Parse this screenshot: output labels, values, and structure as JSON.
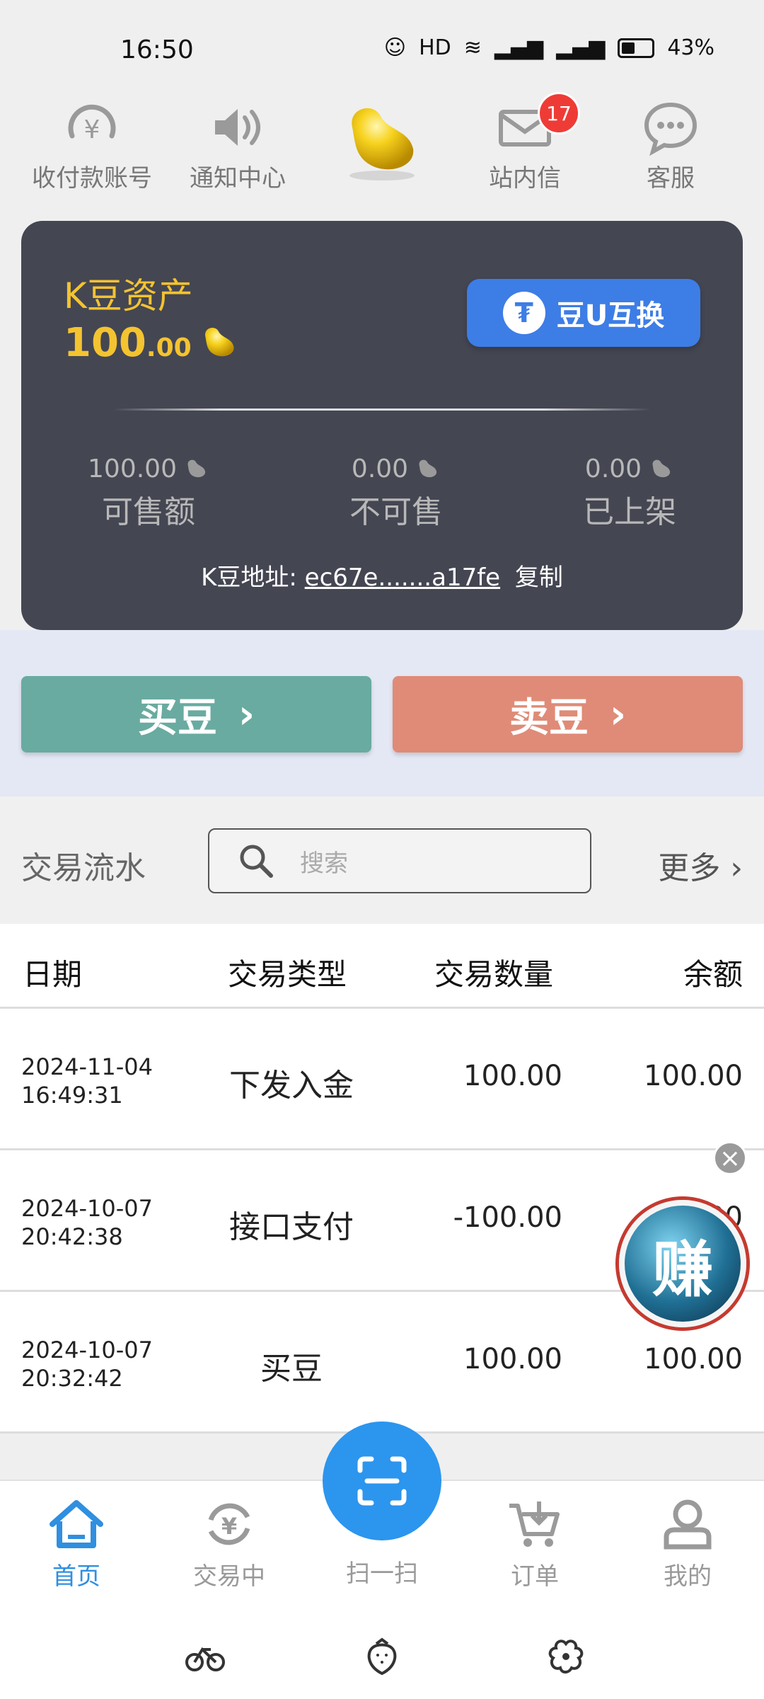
{
  "status": {
    "time": "16:50",
    "battery": "43%"
  },
  "topnav": {
    "items": [
      {
        "label": "收付款账号"
      },
      {
        "label": "通知中心"
      },
      {
        "label": "站内信",
        "badge": "17"
      },
      {
        "label": "客服"
      }
    ]
  },
  "card": {
    "title": "K豆资产",
    "amount_int": "100",
    "amount_dec": ".00",
    "swap_label": "豆U互换",
    "stats": [
      {
        "value": "100.00",
        "label": "可售额"
      },
      {
        "value": "0.00",
        "label": "不可售"
      },
      {
        "value": "0.00",
        "label": "已上架"
      }
    ],
    "address_label": "K豆地址:",
    "address_value": "ec67e.......a17fe",
    "copy_label": "复制"
  },
  "actions": {
    "buy": "买豆",
    "sell": "卖豆"
  },
  "transactions": {
    "title": "交易流水",
    "search_placeholder": "搜索",
    "more": "更多",
    "columns": [
      "日期",
      "交易类型",
      "交易数量",
      "余额"
    ],
    "rows": [
      {
        "date": "2024-11-04",
        "time": "16:49:31",
        "type": "下发入金",
        "qty": "100.00",
        "balance": "100.00"
      },
      {
        "date": "2024-10-07",
        "time": "20:42:38",
        "type": "接口支付",
        "qty": "-100.00",
        "balance": "0.00"
      },
      {
        "date": "2024-10-07",
        "time": "20:32:42",
        "type": "买豆",
        "qty": "100.00",
        "balance": "100.00"
      }
    ]
  },
  "floating": {
    "earn": "赚"
  },
  "bottomnav": {
    "tabs": [
      {
        "label": "首页"
      },
      {
        "label": "交易中"
      },
      {
        "label": "扫一扫"
      },
      {
        "label": "订单"
      },
      {
        "label": "我的"
      }
    ]
  },
  "colors": {
    "accent": "#2c95ee",
    "gold": "#f4c330",
    "buy": "#69aba0",
    "sell": "#df8b77",
    "card": "#444652"
  }
}
